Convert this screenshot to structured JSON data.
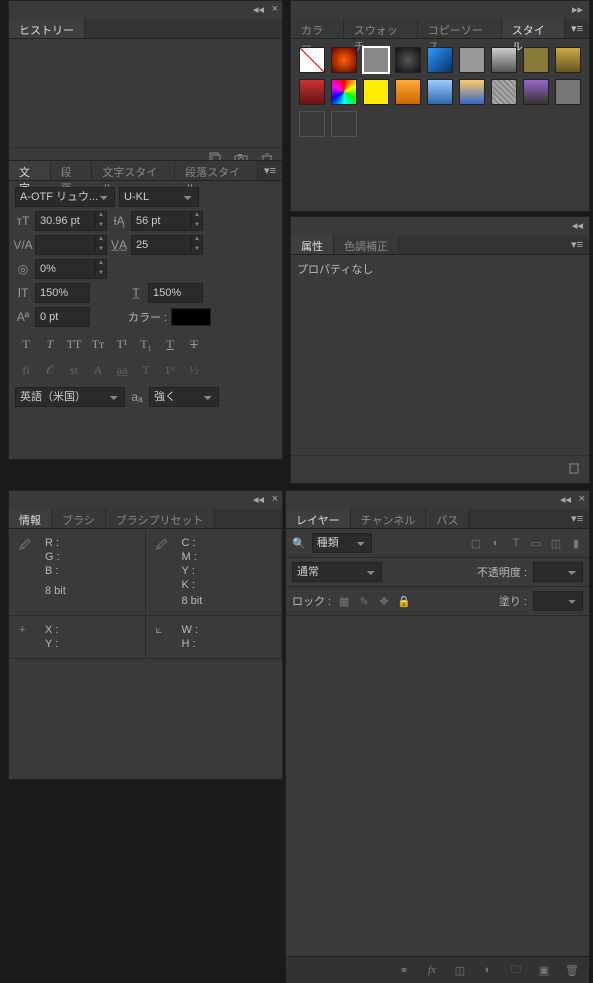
{
  "history": {
    "tab": "ヒストリー"
  },
  "style": {
    "tabs": [
      "カラー",
      "スウォッチ",
      "コピーソース",
      "スタイル"
    ],
    "active_tab": 3,
    "swatches": [
      {
        "type": "none"
      },
      {
        "bg": "radial-gradient(circle,#ff6600,#660000)"
      },
      {
        "bg": "#888",
        "selected": true
      },
      {
        "bg": "radial-gradient(circle,#555,#111)"
      },
      {
        "bg": "linear-gradient(135deg,#3399ff,#003366)"
      },
      {
        "bg": "#999"
      },
      {
        "bg": "linear-gradient(#ccc,#555)"
      },
      {
        "bg": "#8a7a3a"
      },
      {
        "bg": "linear-gradient(#ccaa44,#665522)"
      },
      {
        "bg": "linear-gradient(#cc3333,#661111)"
      },
      {
        "bg": "conic-gradient(#f00,#ff0,#0f0,#0ff,#00f,#f0f,#f00)"
      },
      {
        "bg": "#ffee00"
      },
      {
        "bg": "linear-gradient(#ffaa33,#cc6600)"
      },
      {
        "bg": "linear-gradient(#99ccff,#3366aa)"
      },
      {
        "bg": "linear-gradient(#ffcc66,#3366cc)"
      },
      {
        "bg": "repeating-linear-gradient(45deg,#888,#888 2px,#aaa 2px,#aaa 4px)"
      },
      {
        "bg": "linear-gradient(#9966cc,#333)"
      },
      {
        "bg": "#777"
      },
      {
        "bg": "#3a3a3a",
        "empty": true
      },
      {
        "bg": "#3a3a3a",
        "empty": true
      }
    ]
  },
  "character": {
    "tabs": [
      "文字",
      "段落",
      "文字スタイル",
      "段落スタイル"
    ],
    "active_tab": 0,
    "font_family": "A-OTF リュウ...",
    "font_style": "U-KL",
    "size": "30.96 pt",
    "leading": "56 pt",
    "kerning": "",
    "tracking": "25",
    "baseline_pct": "0%",
    "hscale": "150%",
    "vscale": "150%",
    "baseline_shift": "0 pt",
    "color_label": "カラー :",
    "language": "英語（米国）",
    "anti_alias": "強く",
    "style_buttons": [
      "T",
      "T",
      "TT",
      "Tᴛ",
      "T¹",
      "T₁",
      "T",
      "Ŧ"
    ],
    "opentype_buttons": [
      "fi",
      "𝒪",
      "st",
      "A",
      "a̲a̲",
      "T",
      "1ˢᵗ",
      "½"
    ]
  },
  "attributes": {
    "tabs": [
      "属性",
      "色調補正"
    ],
    "active_tab": 0,
    "message": "プロパティなし"
  },
  "info": {
    "tabs": [
      "情報",
      "ブラシ",
      "ブラシプリセット"
    ],
    "active_tab": 0,
    "rgb_labels": [
      "R :",
      "G :",
      "B :"
    ],
    "cmyk_labels": [
      "C :",
      "M :",
      "Y :",
      "K :"
    ],
    "bit_label": "8 bit",
    "xy_labels": [
      "X :",
      "Y :"
    ],
    "wh_labels": [
      "W :",
      "H :"
    ]
  },
  "layers": {
    "tabs": [
      "レイヤー",
      "チャンネル",
      "パス"
    ],
    "active_tab": 0,
    "filter_label": "種類",
    "blend_mode": "通常",
    "opacity_label": "不透明度 :",
    "lock_label": "ロック :",
    "fill_label": "塗り :"
  }
}
